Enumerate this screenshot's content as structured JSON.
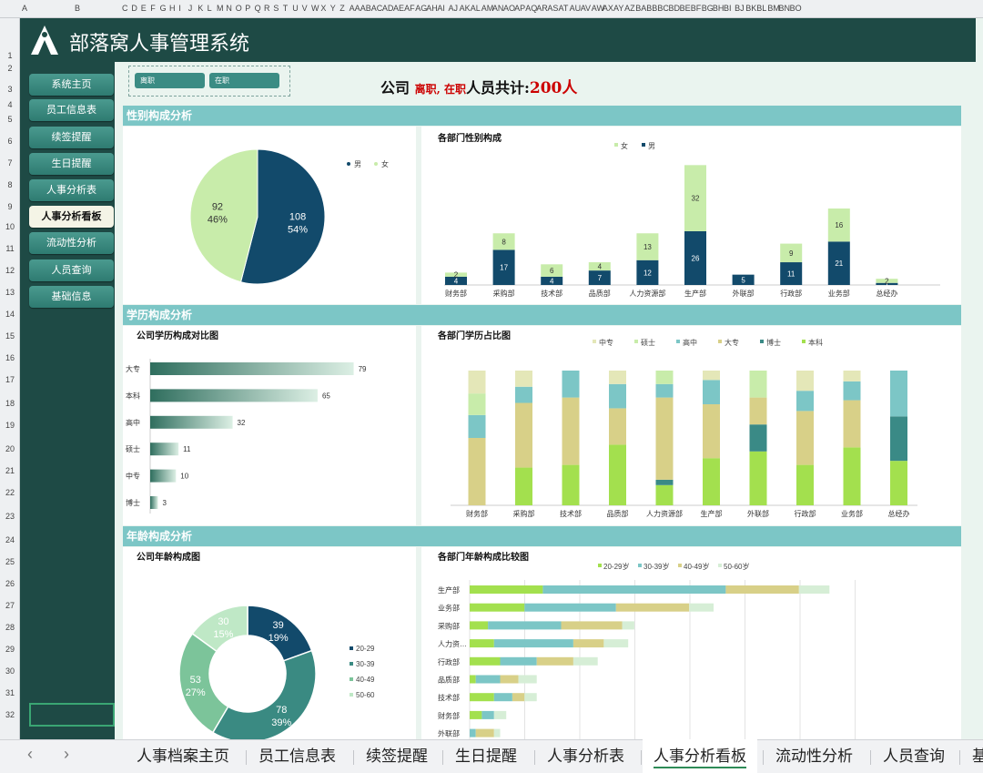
{
  "col_headers": [
    "A",
    "B",
    "C",
    "D",
    "E",
    "F",
    "G",
    "H",
    "I",
    "J",
    "K",
    "L",
    "M",
    "N",
    "O",
    "P",
    "Q",
    "R",
    "S",
    "T",
    "U",
    "V",
    "W",
    "X",
    "Y",
    "Z",
    "AA",
    "AB",
    "AC",
    "AD",
    "AE",
    "AF",
    "AG",
    "AH",
    "AI",
    "AJ",
    "AK",
    "AL",
    "AM",
    "AN",
    "AO",
    "AP",
    "AQ",
    "AR",
    "AS",
    "AT",
    "AU",
    "AV",
    "AW",
    "AX",
    "AY",
    "AZ",
    "BA",
    "BB",
    "BC",
    "BD",
    "BE",
    "BF",
    "BG",
    "BH",
    "BI",
    "BJ",
    "BK",
    "BL",
    "BM",
    "BN",
    "BO"
  ],
  "row_headers": [
    "1",
    "2",
    "3",
    "4",
    "5",
    "6",
    "7",
    "8",
    "9",
    "10",
    "11",
    "12",
    "13",
    "14",
    "15",
    "16",
    "17",
    "18",
    "19",
    "20",
    "21",
    "22",
    "23",
    "24",
    "25",
    "26",
    "27",
    "28",
    "29",
    "30",
    "31",
    "32"
  ],
  "app_title": "部落窝人事管理系统",
  "nav": [
    {
      "label": "系统主页",
      "active": false
    },
    {
      "label": "员工信息表",
      "active": false
    },
    {
      "label": "续签提醒",
      "active": false
    },
    {
      "label": "生日提醒",
      "active": false
    },
    {
      "label": "人事分析表",
      "active": false
    },
    {
      "label": "人事分析看板",
      "active": true
    },
    {
      "label": "流动性分析",
      "active": false
    },
    {
      "label": "人员查询",
      "active": false
    },
    {
      "label": "基础信息",
      "active": false
    }
  ],
  "filters": {
    "chip1": "离职",
    "chip2": "在职"
  },
  "summary": {
    "prefix": "公司",
    "status": "离职, 在职",
    "mid": "人员共计:",
    "count": "200人"
  },
  "sections": {
    "gender": "性别构成分析",
    "edu": "学历构成分析",
    "age": "年龄构成分析"
  },
  "colors": {
    "dark_teal": "#1e4a45",
    "male": "#124a6b",
    "female": "#c8ecaa",
    "section": "#7cc6c6"
  },
  "gender_pie": {
    "legend": [
      "男",
      "女"
    ],
    "chart_data": {
      "type": "pie",
      "title": "",
      "slices": [
        {
          "name": "男",
          "value": 108,
          "percent": "54%"
        },
        {
          "name": "女",
          "value": 92,
          "percent": "46%"
        }
      ]
    }
  },
  "dept_gender": {
    "title": "各部门性别构成",
    "legend": [
      "女",
      "男"
    ],
    "chart_data": {
      "type": "bar",
      "stacked": true,
      "categories": [
        "财务部",
        "采购部",
        "技术部",
        "品质部",
        "人力资源部",
        "生产部",
        "外联部",
        "行政部",
        "业务部",
        "总经办"
      ],
      "series": [
        {
          "name": "男",
          "values": [
            4,
            17,
            4,
            7,
            12,
            26,
            5,
            11,
            21,
            1
          ]
        },
        {
          "name": "女",
          "values": [
            2,
            8,
            6,
            4,
            13,
            32,
            0,
            9,
            16,
            2
          ]
        }
      ]
    }
  },
  "edu_bar": {
    "title": "公司学历构成对比图",
    "chart_data": {
      "type": "bar",
      "orientation": "horizontal",
      "categories": [
        "大专",
        "本科",
        "高中",
        "硕士",
        "中专",
        "博士"
      ],
      "values": [
        79,
        65,
        32,
        11,
        10,
        3
      ]
    }
  },
  "dept_edu": {
    "title": "各部门学历占比图",
    "legend": [
      "中专",
      "硕士",
      "高中",
      "大专",
      "博士",
      "本科"
    ],
    "chart_data": {
      "type": "bar",
      "stacked": true,
      "percent": true,
      "categories": [
        "财务部",
        "采购部",
        "技术部",
        "品质部",
        "人力资源部",
        "生产部",
        "外联部",
        "行政部",
        "业务部",
        "总经办"
      ],
      "series": [
        {
          "name": "本科",
          "color": "#a3e04e",
          "values": [
            0,
            28,
            30,
            45,
            15,
            35,
            40,
            30,
            43,
            33
          ]
        },
        {
          "name": "博士",
          "color": "#3a8a86",
          "values": [
            0,
            0,
            0,
            0,
            4,
            0,
            20,
            0,
            0,
            33
          ]
        },
        {
          "name": "大专",
          "color": "#d8d088",
          "values": [
            50,
            48,
            50,
            27,
            61,
            40,
            20,
            40,
            35,
            0
          ]
        },
        {
          "name": "高中",
          "color": "#7cc6c6",
          "values": [
            17,
            12,
            20,
            18,
            10,
            18,
            0,
            15,
            14,
            34
          ]
        },
        {
          "name": "硕士",
          "color": "#c8ecaa",
          "values": [
            16,
            0,
            0,
            0,
            10,
            0,
            20,
            0,
            0,
            0
          ]
        },
        {
          "name": "中专",
          "color": "#e4e7b8",
          "values": [
            17,
            12,
            0,
            10,
            0,
            7,
            0,
            15,
            8,
            0
          ]
        }
      ]
    }
  },
  "age_donut": {
    "title": "公司年龄构成图",
    "legend": [
      "20-29",
      "30-39",
      "40-49",
      "50-60"
    ],
    "chart_data": {
      "type": "pie",
      "donut": true,
      "slices": [
        {
          "name": "20-29",
          "value": 39,
          "percent": "19%",
          "color": "#124a6b"
        },
        {
          "name": "30-39",
          "value": 78,
          "percent": "39%",
          "color": "#3a8a82"
        },
        {
          "name": "40-49",
          "value": 53,
          "percent": "27%",
          "color": "#7cc49a"
        },
        {
          "name": "50-60",
          "value": 30,
          "percent": "15%",
          "color": "#bfe8c6"
        }
      ]
    }
  },
  "dept_age": {
    "title": "各部门年龄构成比较图",
    "legend": [
      "20-29岁",
      "30-39岁",
      "40-49岁",
      "50-60岁"
    ],
    "chart_data": {
      "type": "bar",
      "orientation": "horizontal",
      "stacked": true,
      "categories": [
        "生产部",
        "业务部",
        "采购部",
        "人力资…",
        "行政部",
        "品质部",
        "技术部",
        "财务部",
        "外联部"
      ],
      "series": [
        {
          "name": "20-29岁",
          "color": "#a3e04e",
          "values": [
            12,
            9,
            3,
            4,
            5,
            1,
            4,
            2,
            0
          ]
        },
        {
          "name": "30-39岁",
          "color": "#7cc6c6",
          "values": [
            30,
            15,
            12,
            13,
            6,
            4,
            3,
            2,
            1
          ]
        },
        {
          "name": "40-49岁",
          "color": "#d8d088",
          "values": [
            12,
            12,
            10,
            5,
            6,
            3,
            2,
            0,
            3
          ]
        },
        {
          "name": "50-60岁",
          "color": "#d6eed6",
          "values": [
            5,
            4,
            2,
            4,
            4,
            3,
            2,
            2,
            1
          ]
        }
      ]
    }
  },
  "sheet_tabs": [
    {
      "label": "人事档案主页",
      "active": false
    },
    {
      "label": "员工信息表",
      "active": false
    },
    {
      "label": "续签提醒",
      "active": false
    },
    {
      "label": "生日提醒",
      "active": false
    },
    {
      "label": "人事分析表",
      "active": false
    },
    {
      "label": "人事分析看板",
      "active": true
    },
    {
      "label": "流动性分析",
      "active": false
    },
    {
      "label": "人员查询",
      "active": false
    },
    {
      "label": "基",
      "active": false
    }
  ]
}
